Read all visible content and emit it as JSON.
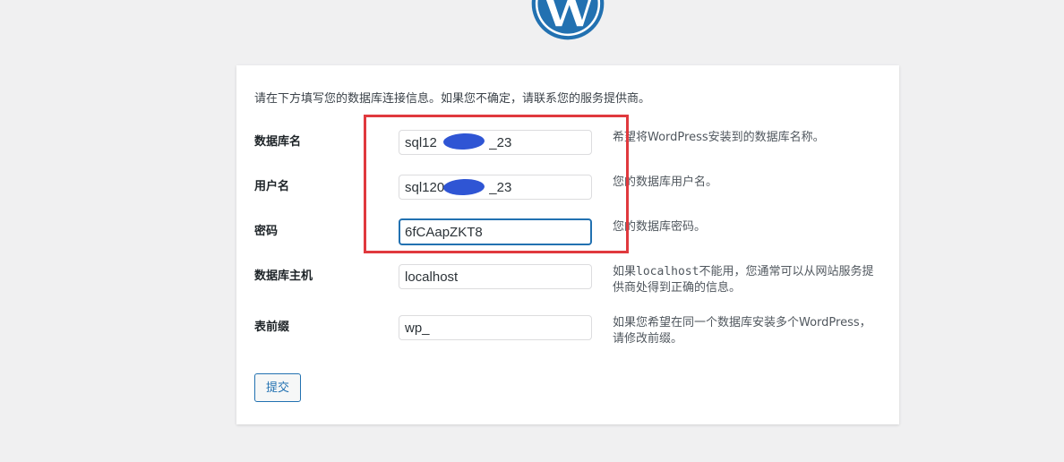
{
  "logo": {
    "icon": "wordpress-logo-icon",
    "color": "#2271b1"
  },
  "intro": "请在下方填写您的数据库连接信息。如果您不确定，请联系您的服务提供商。",
  "fields": {
    "dbname": {
      "label": "数据库名",
      "value": "sql12       _23",
      "desc": "希望将WordPress安装到的数据库名称。"
    },
    "username": {
      "label": "用户名",
      "value": "sql120      _23",
      "desc": "您的数据库用户名。"
    },
    "password": {
      "label": "密码",
      "value": "6fCAapZKT8",
      "desc": "您的数据库密码。"
    },
    "dbhost": {
      "label": "数据库主机",
      "value": "localhost",
      "desc_pre": "如果",
      "desc_code": "localhost",
      "desc_post": "不能用，您通常可以从网站服务提供商处得到正确的信息。"
    },
    "prefix": {
      "label": "表前缀",
      "value": "wp_",
      "desc": "如果您希望在同一个数据库安装多个WordPress，请修改前缀。"
    }
  },
  "submit_label": "提交",
  "colors": {
    "accent": "#2271b1",
    "highlight": "#e0393e",
    "redaction": "#2f55d4"
  }
}
